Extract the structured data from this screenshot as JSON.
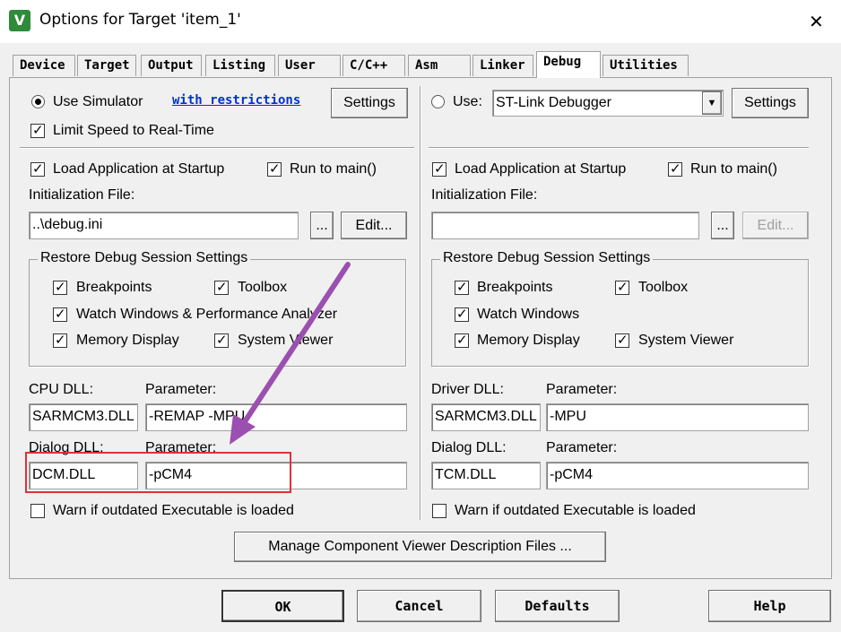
{
  "window": {
    "title": "Options for Target 'item_1'",
    "icon": "uvision-app-icon",
    "close_glyph": "✕",
    "icon_letter": "V"
  },
  "tabs": [
    {
      "label": "Device",
      "active": false
    },
    {
      "label": "Target",
      "active": false
    },
    {
      "label": "Output",
      "active": false
    },
    {
      "label": "Listing",
      "active": false
    },
    {
      "label": "User",
      "active": false
    },
    {
      "label": "C/C++",
      "active": false
    },
    {
      "label": "Asm",
      "active": false
    },
    {
      "label": "Linker",
      "active": false
    },
    {
      "label": "Debug",
      "active": true
    },
    {
      "label": "Utilities",
      "active": false
    }
  ],
  "left": {
    "use_simulator": "Use Simulator",
    "with_restrictions": "with restrictions",
    "settings": "Settings",
    "limit_speed": "Limit Speed to Real-Time",
    "load_app": "Load Application at Startup",
    "run_to_main": "Run to main()",
    "init_file_label": "Initialization File:",
    "init_file_value": "..\\debug.ini",
    "browse": "...",
    "edit": "Edit...",
    "restore_group": "Restore Debug Session Settings",
    "breakpoints": "Breakpoints",
    "toolbox": "Toolbox",
    "watch_windows": "Watch Windows & Performance Analyzer",
    "memory_display": "Memory Display",
    "system_viewer": "System Viewer",
    "cpu_dll_label": "CPU DLL:",
    "cpu_param_label": "Parameter:",
    "cpu_dll_value": "SARMCM3.DLL",
    "cpu_param_value": "-REMAP -MPU",
    "dialog_dll_label": "Dialog DLL:",
    "dialog_param_label": "Parameter:",
    "dialog_dll_value": "DCM.DLL",
    "dialog_param_value": "-pCM4",
    "warn_outdated": "Warn if outdated Executable is loaded"
  },
  "right": {
    "use": "Use:",
    "debugger": "ST-Link Debugger",
    "settings": "Settings",
    "load_app": "Load Application at Startup",
    "run_to_main": "Run to main()",
    "init_file_label": "Initialization File:",
    "init_file_value": "",
    "browse": "...",
    "edit": "Edit...",
    "restore_group": "Restore Debug Session Settings",
    "breakpoints": "Breakpoints",
    "toolbox": "Toolbox",
    "watch_windows": "Watch Windows",
    "memory_display": "Memory Display",
    "system_viewer": "System Viewer",
    "driver_dll_label": "Driver DLL:",
    "driver_param_label": "Parameter:",
    "driver_dll_value": "SARMCM3.DLL",
    "driver_param_value": "-MPU",
    "dialog_dll_label": "Dialog DLL:",
    "dialog_param_label": "Parameter:",
    "dialog_dll_value": "TCM.DLL",
    "dialog_param_value": "-pCM4",
    "warn_outdated": "Warn if outdated Executable is loaded"
  },
  "manage_button": "Manage Component Viewer Description Files ...",
  "footer": {
    "ok": "OK",
    "cancel": "Cancel",
    "defaults": "Defaults",
    "help": "Help"
  },
  "annotation_colors": {
    "highlight_box": "#e0303a",
    "arrow": "#9b4fb0"
  }
}
